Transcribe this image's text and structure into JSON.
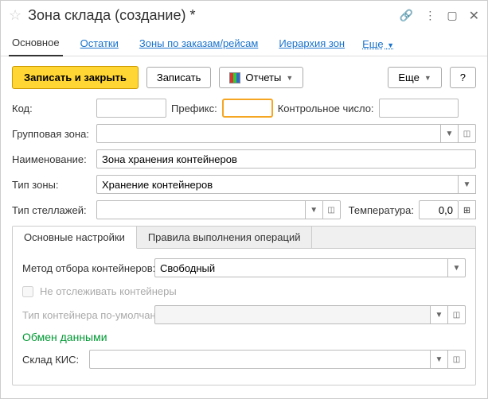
{
  "titlebar": {
    "title": "Зона склада (создание) *"
  },
  "nav": {
    "main": "Основное",
    "balances": "Остатки",
    "byorders": "Зоны по заказам/рейсам",
    "hierarchy": "Иерархия зон",
    "more": "Еще"
  },
  "toolbar": {
    "save_close": "Записать и закрыть",
    "save": "Записать",
    "reports": "Отчеты",
    "more": "Еще",
    "help": "?"
  },
  "fields": {
    "code_lbl": "Код:",
    "code": "",
    "prefix_lbl": "Префикс:",
    "prefix": "",
    "control_lbl": "Контрольное число:",
    "control": "",
    "group_lbl": "Групповая зона:",
    "group": "",
    "name_lbl": "Наименование:",
    "name": "Зона хранения контейнеров",
    "type_lbl": "Тип зоны:",
    "type": "Хранение контейнеров",
    "rack_lbl": "Тип стеллажей:",
    "rack": "",
    "temp_lbl": "Температура:",
    "temp": "0,0"
  },
  "innerTabs": {
    "settings": "Основные настройки",
    "rules": "Правила выполнения операций"
  },
  "settings": {
    "method_lbl": "Метод отбора контейнеров:",
    "method": "Свободный",
    "track_lbl": "Не отслеживать контейнеры",
    "default_type_lbl": "Тип контейнера по-умолчанию:",
    "default_type": "",
    "exchange_title": "Обмен данными",
    "kis_lbl": "Склад КИС:",
    "kis": ""
  }
}
